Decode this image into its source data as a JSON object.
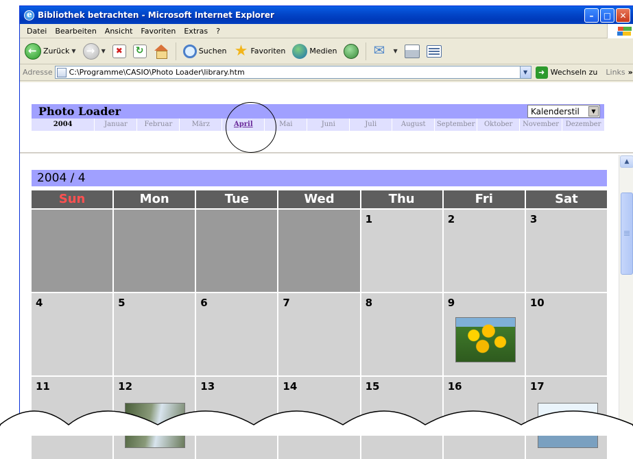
{
  "window": {
    "title": "Bibliothek betrachten - Microsoft Internet Explorer"
  },
  "menu": [
    "Datei",
    "Bearbeiten",
    "Ansicht",
    "Favoriten",
    "Extras",
    "?"
  ],
  "toolbar": {
    "back": "Zurück",
    "search": "Suchen",
    "favorites": "Favoriten",
    "media": "Medien"
  },
  "address": {
    "label": "Adresse",
    "value": "C:\\Programme\\CASIO\\Photo Loader\\library.htm",
    "go": "Wechseln zu",
    "links": "Links",
    "links_more": "»"
  },
  "page": {
    "app_title": "Photo Loader",
    "view_style": "Kalenderstil",
    "year": "2004",
    "months": [
      "Januar",
      "Februar",
      "März",
      "April",
      "Mai",
      "Juni",
      "Juli",
      "August",
      "September",
      "Oktober",
      "November",
      "Dezember"
    ],
    "active_month": "April"
  },
  "calendar": {
    "heading": "2004 / 4",
    "weekdays": [
      "Sun",
      "Mon",
      "Tue",
      "Wed",
      "Thu",
      "Fri",
      "Sat"
    ],
    "days": [
      "",
      "",
      "",
      "",
      "1",
      "2",
      "3",
      "4",
      "5",
      "6",
      "7",
      "8",
      "9",
      "10",
      "11",
      "12",
      "13",
      "14",
      "15",
      "16",
      "17"
    ],
    "photo_days": {
      "9": "flower",
      "12": "water",
      "17": "tree"
    }
  },
  "colors": {
    "header_band": "#a0a0ff",
    "month_row": "#e0e0ff",
    "weekday_header": "#5e5e5e",
    "sunday_text": "#ff5050",
    "day_cell": "#d2d2d2",
    "empty_cell": "#9a9a9a"
  }
}
